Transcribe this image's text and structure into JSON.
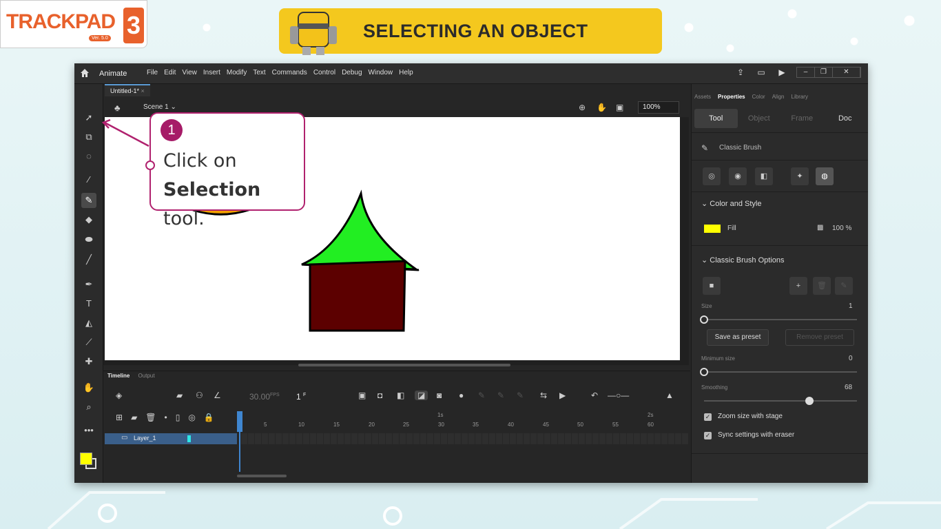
{
  "logo": {
    "brand": "TRACKPAD",
    "version": "Ver. 5.0",
    "number": "3"
  },
  "banner": {
    "title": "SELECTING AN OBJECT"
  },
  "app": {
    "name": "Animate",
    "menus": [
      "File",
      "Edit",
      "View",
      "Insert",
      "Modify",
      "Text",
      "Commands",
      "Control",
      "Debug",
      "Window",
      "Help"
    ],
    "document_tab": "Untitled-1*",
    "scene": "Scene 1",
    "zoom": "100%"
  },
  "callout": {
    "step": "1",
    "line1": "Click on",
    "bold": "Selection",
    "rest": " tool."
  },
  "timeline": {
    "tabs": [
      "Timeline",
      "Output"
    ],
    "fps": "30.00",
    "fps_unit": "FPS",
    "frame": "1",
    "frame_unit": "F",
    "layer": "Layer_1",
    "ruler_marks": [
      "5",
      "10",
      "15",
      "20",
      "25",
      "30",
      "35",
      "40",
      "45",
      "50",
      "55",
      "60"
    ],
    "time_marks": [
      "1s",
      "2s"
    ]
  },
  "properties": {
    "tabs": [
      "Assets",
      "Properties",
      "Color",
      "Align",
      "Library"
    ],
    "subtabs": [
      "Tool",
      "Object",
      "Frame",
      "Doc"
    ],
    "tool_name": "Classic Brush",
    "color_section": "Color and Style",
    "fill_label": "Fill",
    "fill_color": "#ffff00",
    "fill_alpha": "100 %",
    "brush_section": "Classic Brush Options",
    "size_label": "Size",
    "size_value": "1",
    "save_preset": "Save as preset",
    "remove_preset": "Remove preset",
    "min_size_label": "Minimum size",
    "min_size_value": "0",
    "smoothing_label": "Smoothing",
    "smoothing_value": "68",
    "zoom_with_stage": "Zoom size with stage",
    "sync_eraser": "Sync settings with eraser"
  },
  "colors": {
    "accent": "#b0216e",
    "banner": "#f4c81e",
    "brand": "#e8612c",
    "roof": "#22ee22",
    "house": "#5c0000"
  }
}
